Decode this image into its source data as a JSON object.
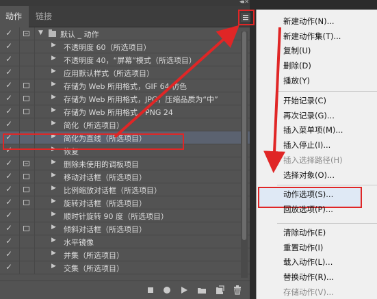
{
  "tabs": {
    "actions": "动作",
    "links": "链接"
  },
  "set": {
    "name": "默认 _ 动作"
  },
  "actions": [
    {
      "label": "不透明度 60（所选项目）",
      "box": false,
      "dash": false
    },
    {
      "label": "不透明度 40，“屏幕”模式（所选项目）",
      "box": false,
      "dash": false
    },
    {
      "label": "应用默认样式（所选项目）",
      "box": false,
      "dash": false
    },
    {
      "label": "存储为 Web 所用格式，GIF 64 仿色",
      "box": true,
      "dash": false
    },
    {
      "label": "存储为 Web 所用格式，JPG，压缩品质为“中”",
      "box": true,
      "dash": false
    },
    {
      "label": "存储为 Web 所用格式，PNG 24",
      "box": true,
      "dash": false
    },
    {
      "label": "简化（所选项目）",
      "box": false,
      "dash": false
    },
    {
      "label": "简化为直线（所选项目）",
      "box": false,
      "dash": false,
      "selected": true
    },
    {
      "label": "恢复",
      "box": false,
      "dash": false
    },
    {
      "label": "删除未使用的调板项目",
      "box": true,
      "dash": true
    },
    {
      "label": "移动对话框（所选项目）",
      "box": true,
      "dash": false
    },
    {
      "label": "比例缩放对话框（所选项目）",
      "box": true,
      "dash": false
    },
    {
      "label": "旋转对话框（所选项目）",
      "box": true,
      "dash": false
    },
    {
      "label": "顺时针旋转 90 度（所选项目）",
      "box": false,
      "dash": false
    },
    {
      "label": "倾斜对话框（所选项目）",
      "box": true,
      "dash": false
    },
    {
      "label": "水平镜像",
      "box": false,
      "dash": false
    },
    {
      "label": "并集（所选项目）",
      "box": false,
      "dash": false
    },
    {
      "label": "交集（所选项目）",
      "box": false,
      "dash": false
    }
  ],
  "bottom_icons": [
    "stop-icon",
    "record-icon",
    "play-icon",
    "new-set-icon",
    "new-action-icon",
    "delete-icon"
  ],
  "menu": {
    "groups": [
      [
        "新建动作(N)...",
        "新建动作集(T)...",
        "复制(U)",
        "删除(D)",
        "播放(Y)"
      ],
      [
        "开始记录(C)",
        "再次记录(G)...",
        "插入菜单项(M)...",
        "插入停止(I)...",
        "插入选择路径(H)",
        "选择对象(O)..."
      ],
      [
        "动作选项(S)...",
        "回放选项(P)..."
      ],
      [
        "清除动作(E)",
        "重置动作(I)",
        "载入动作(L)...",
        "替换动作(R)...",
        "存储动作(V)..."
      ]
    ],
    "disabled": [
      "插入选择路径(H)",
      "存储动作(V)..."
    ]
  },
  "colors": {
    "highlight": "#e02626",
    "panel": "#535353",
    "menu_bg": "#f0f0f0",
    "selected_row": "#5b6270"
  }
}
